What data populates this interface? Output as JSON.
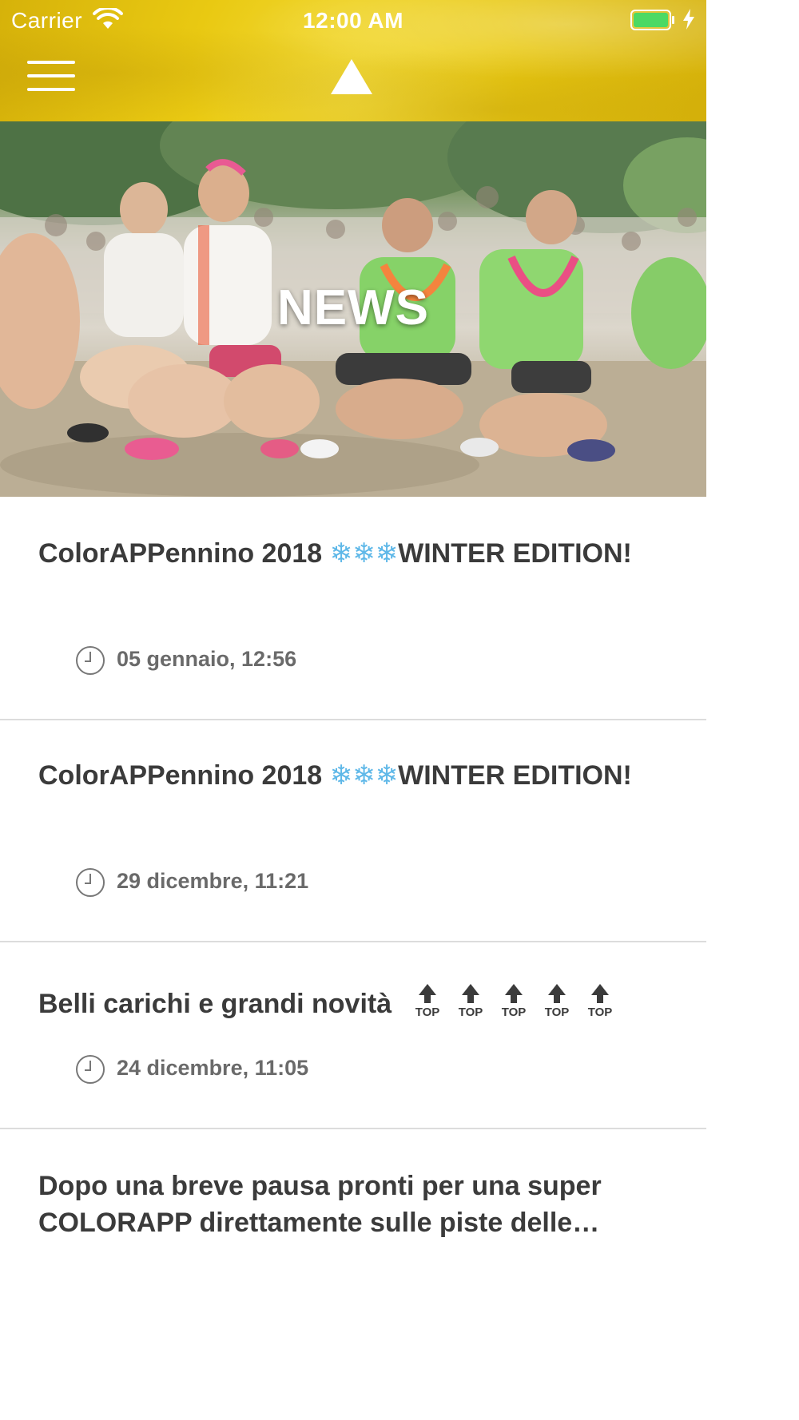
{
  "status_bar": {
    "carrier": "Carrier",
    "time": "12:00 AM",
    "battery_color": "#4cd964"
  },
  "header": {
    "menu_icon": "hamburger-menu-icon",
    "logo_icon": "triangle-logo-icon",
    "background_color": "#e9c912"
  },
  "hero": {
    "title": "NEWS",
    "image": "crowd of color-run participants squatting outdoors"
  },
  "news": [
    {
      "title_text": "ColorAPPennino 2018 ",
      "title_emoji": "❄❄❄",
      "title_suffix": "WINTER EDITION!",
      "date": "05 gennaio, 12:56"
    },
    {
      "title_text": "ColorAPPennino 2018 ",
      "title_emoji": "❄❄❄",
      "title_suffix": "WINTER EDITION!",
      "date": "29 dicembre, 11:21"
    },
    {
      "title_text": "Belli carichi e grandi novità",
      "top_icon_label": "TOP",
      "top_icon_count": 5,
      "date": "24 dicembre, 11:05"
    },
    {
      "title_text": "Dopo una breve pausa pronti per una super COLORAPP direttamente sulle piste delle…"
    }
  ]
}
